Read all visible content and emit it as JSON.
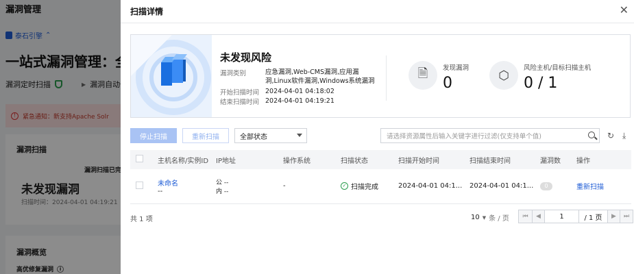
{
  "background": {
    "crumb": "漏洞管理",
    "brand": "泰石引擎",
    "hero": "一站式漏洞管理：全",
    "sub_items": [
      "漏洞定时扫描",
      "漏洞自动修"
    ],
    "notice": "紧急通知：新支持Apache Solr",
    "card1": {
      "title": "漏洞扫描",
      "status": "漏洞扫描已完",
      "result": "未发现漏洞",
      "time": "扫描时间：2024-04-01 04:19:21"
    },
    "card2": {
      "title": "漏洞概览",
      "item": "高优修复漏洞"
    }
  },
  "drawer": {
    "title": "扫描详情",
    "summary": {
      "title": "未发现风险",
      "vuln_type_label": "漏洞类别",
      "vuln_type_value": "应急漏洞,Web-CMS漏洞,应用漏洞,Linux软件漏洞,Windows系统漏洞",
      "start_label": "开始扫描时间",
      "start_value": "2024-04-01 04:18:02",
      "end_label": "结束扫描时间",
      "end_value": "2024-04-01 04:19:21",
      "found_label": "发现漏洞",
      "found_value": "0",
      "hosts_label": "风险主机/目标扫描主机",
      "hosts_value": "0 / 1"
    },
    "toolbar": {
      "stop_label": "停止扫描",
      "rescan_label": "重新扫描",
      "status_select": "全部状态",
      "search_placeholder": "请选择资源属性后输入关键字进行过滤(仅支持单个值)"
    },
    "table": {
      "headers": [
        "主机名称/实例ID",
        "IP地址",
        "操作系统",
        "扫描状态",
        "扫描开始时间",
        "扫描结束时间",
        "漏洞数",
        "操作"
      ],
      "rows": [
        {
          "name": "未命名",
          "instance": "--",
          "ip_public": "公 --",
          "ip_private": "内 --",
          "os": "-",
          "status": "扫描完成",
          "start": "2024-04-01 04:1...",
          "end": "2024-04-01 04:1...",
          "vulns": "0",
          "action": "重新扫描"
        }
      ]
    },
    "footer": {
      "total": "共 1 项",
      "page_size": "10",
      "page_size_unit": "条 / 页",
      "page_input": "1",
      "page_total": "/ 1 页"
    }
  }
}
